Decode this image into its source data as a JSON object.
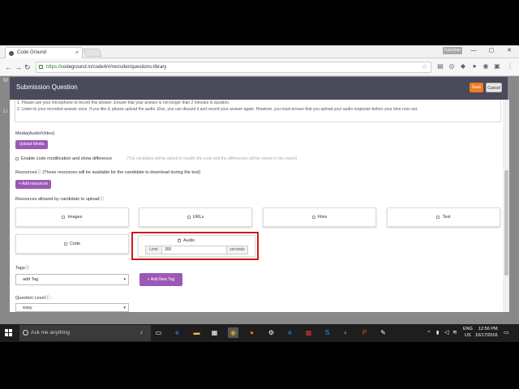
{
  "browser": {
    "tab_title": "Code Ground",
    "tab_close": "×",
    "user_badge": "Kanchan",
    "win_min": "—",
    "win_max": "▢",
    "win_close": "✕",
    "back": "←",
    "forward": "→",
    "reload": "↻",
    "url_scheme": "https://",
    "url_rest": "codeground.in/code4/#/recruiter/questions-library",
    "star": "☆"
  },
  "background": {
    "label_top": "M",
    "label_side": "Li"
  },
  "modal": {
    "title": "Submission Question",
    "save_label": "Save",
    "cancel_label": "Cancel",
    "instructions": [
      "1. Please use your microphone to record this answer. Ensure that your answer is not longer than 2 minutes in duration.",
      "2. Listen to your recorded answer once. If you like it, please upload the audio. Else, you can discard it and record your answer again. However, you must ensure that you upload your audio response before your time runs out."
    ],
    "media_label": "Media(Audio/Video)",
    "upload_media": "Upload Media",
    "code_mod_label": "Enable code modification and show difference",
    "code_mod_hint": "(The candidate will be asked to modify the code and the differences will be shown in the report)",
    "resources_label": "Resourcesⓘ (These resources will be available for the candidate to download during the test)",
    "add_resources": "+ Add resources",
    "allowed_label": "Resources allowed by candidate to uploadⓘ",
    "resource_types": [
      "Images",
      "URLs",
      "Files",
      "Text",
      "Code"
    ],
    "audio": {
      "label": "Audio",
      "limit_prefix": "Limit",
      "limit_value": "300",
      "limit_suffix": "seconds"
    },
    "tags_label": "Tagsⓘ",
    "tag_placeholder": "add Tag",
    "add_new_tag": "+ Add New Tag",
    "level_label": "Question Levelⓘ :",
    "level_value": "easy"
  },
  "taskbar": {
    "search_placeholder": "Ask me anything",
    "lang_top": "ENG",
    "lang_bottom": "US",
    "time": "12:56 PM",
    "date": "10/17/2016"
  },
  "colors": {
    "accent_purple": "#9b59b6",
    "save_orange": "#f07b24",
    "highlight_red": "#cc1b1b",
    "modal_header": "#4a4a5a"
  }
}
